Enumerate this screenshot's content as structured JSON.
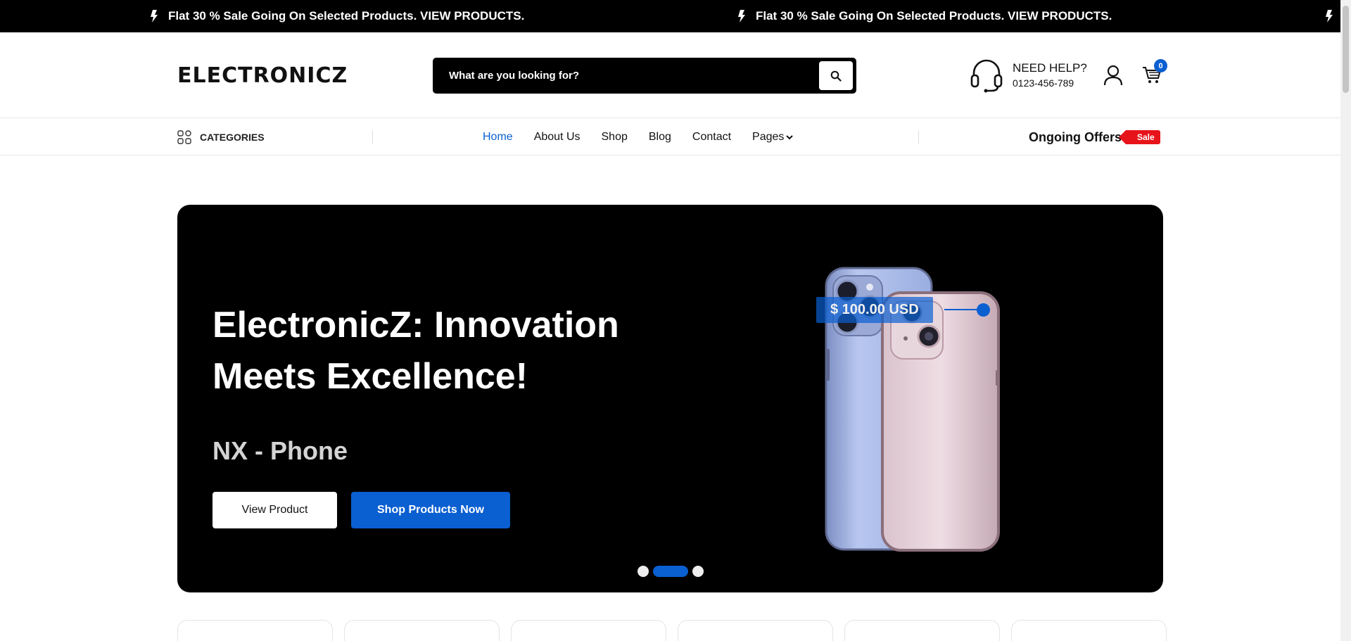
{
  "promo": {
    "messages": [
      "Flat 30 % Sale Going On Selected Products. VIEW PRODUCTS.",
      "Flat 30 % Sale Going On Selected Products. VIEW PRODUCTS."
    ]
  },
  "header": {
    "logo": "ELECTRONICZ",
    "search_placeholder": "What are you looking for?",
    "help_title": "NEED HELP?",
    "help_phone": "0123-456-789",
    "cart_count": "0"
  },
  "nav": {
    "categories_label": "CATEGORIES",
    "menu": [
      "Home",
      "About Us",
      "Shop",
      "Blog",
      "Contact",
      "Pages"
    ],
    "active_item": "Home",
    "offers_label": "Ongoing Offers",
    "offers_badge": "Sale"
  },
  "hero": {
    "title": "ElectronicZ: Innovation Meets Excellence!",
    "subtitle": "NX - Phone",
    "view_button": "View Product",
    "shop_button": "Shop Products Now",
    "price": "$ 100.00 USD",
    "slides": 3,
    "active_slide": 2
  },
  "colors": {
    "accent": "#0a5fd1",
    "sale": "#e6141a",
    "promo_bg": "#000000",
    "hero_bg": "#000000"
  },
  "icons": [
    "bolt-icon",
    "search-icon",
    "headset-icon",
    "user-icon",
    "cart-icon",
    "grid-icon",
    "chevron-down-icon"
  ]
}
